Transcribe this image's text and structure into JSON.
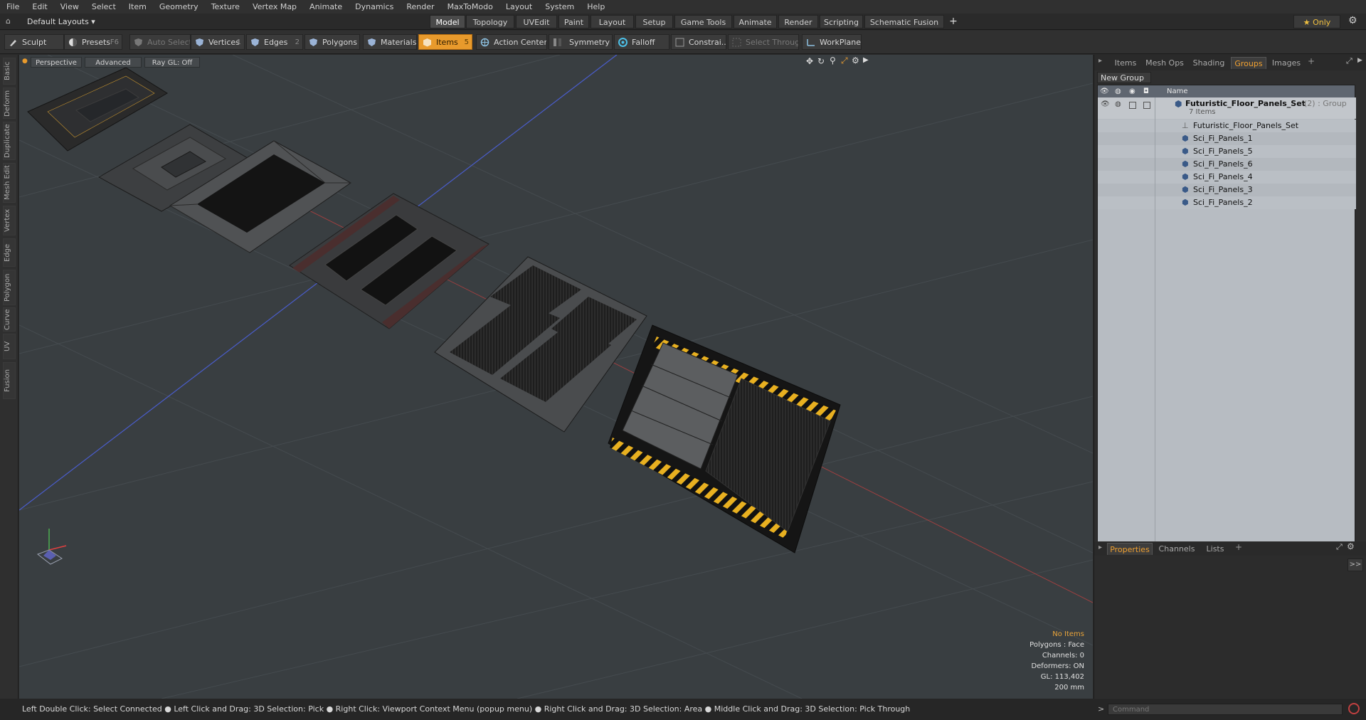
{
  "menu": [
    "File",
    "Edit",
    "View",
    "Select",
    "Item",
    "Geometry",
    "Texture",
    "Vertex Map",
    "Animate",
    "Dynamics",
    "Render",
    "MaxToModo",
    "Layout",
    "System",
    "Help"
  ],
  "layout_selector": "Default Layouts ▾",
  "layout_tabs": [
    "Model",
    "Topology",
    "UVEdit",
    "Paint",
    "Layout",
    "Setup",
    "Game Tools",
    "Animate",
    "Render",
    "Scripting",
    "Schematic Fusion"
  ],
  "layout_active": "Model",
  "only_label": "★ Only",
  "toolbar": {
    "sculpt": "Sculpt",
    "presets": "Presets",
    "presets_key": "F6",
    "auto_select": "Auto Select",
    "vertices": "Vertices",
    "vertices_count": "1",
    "edges": "Edges",
    "edges_count": "2",
    "polygons": "Polygons",
    "materials": "Materials",
    "items": "Items",
    "items_count": "5",
    "action_center": "Action Center",
    "symmetry": "Symmetry",
    "falloff": "Falloff",
    "constrain": "Constrai...",
    "select_through": "Select Through",
    "workplane": "WorkPlane"
  },
  "left_tabs": [
    "Basic",
    "Deform",
    "Duplicate",
    "Mesh Edit",
    "Vertex",
    "Edge",
    "Polygon",
    "Curve",
    "UV",
    "Fusion"
  ],
  "viewport": {
    "perspective": "Perspective",
    "advanced": "Advanced",
    "raygl": "Ray GL: Off",
    "overlay": {
      "no_items": "No Items",
      "polygons": "Polygons : Face",
      "channels": "Channels: 0",
      "deformers": "Deformers: ON",
      "gl": "GL: 113,402",
      "size": "200 mm"
    }
  },
  "right_panel": {
    "tabs": [
      "Items",
      "Mesh Ops",
      "Shading",
      "Groups",
      "Images"
    ],
    "active_tab": "Groups",
    "new_group": "New Group",
    "name_header": "Name",
    "group_name": "Futuristic_Floor_Panels_Set",
    "group_suffix": "(2) : Group",
    "group_count": "7 Items",
    "items": [
      "Futuristic_Floor_Panels_Set",
      "Sci_Fi_Panels_1",
      "Sci_Fi_Panels_5",
      "Sci_Fi_Panels_6",
      "Sci_Fi_Panels_4",
      "Sci_Fi_Panels_3",
      "Sci_Fi_Panels_2"
    ],
    "bottom_tabs": [
      "Properties",
      "Channels",
      "Lists"
    ],
    "bottom_active": "Properties",
    "command_placeholder": "Command"
  },
  "status_bar": "Left Double Click: Select Connected ● Left Click and Drag: 3D Selection: Pick ● Right Click: Viewport Context Menu (popup menu) ● Right Click and Drag: 3D Selection: Area ● Middle Click and Drag: 3D Selection: Pick Through",
  "colors": {
    "accent": "#e89a2c",
    "grid_blue": "#4a5dcc",
    "grid_red": "#b84040",
    "hazard": "#e8b020"
  }
}
